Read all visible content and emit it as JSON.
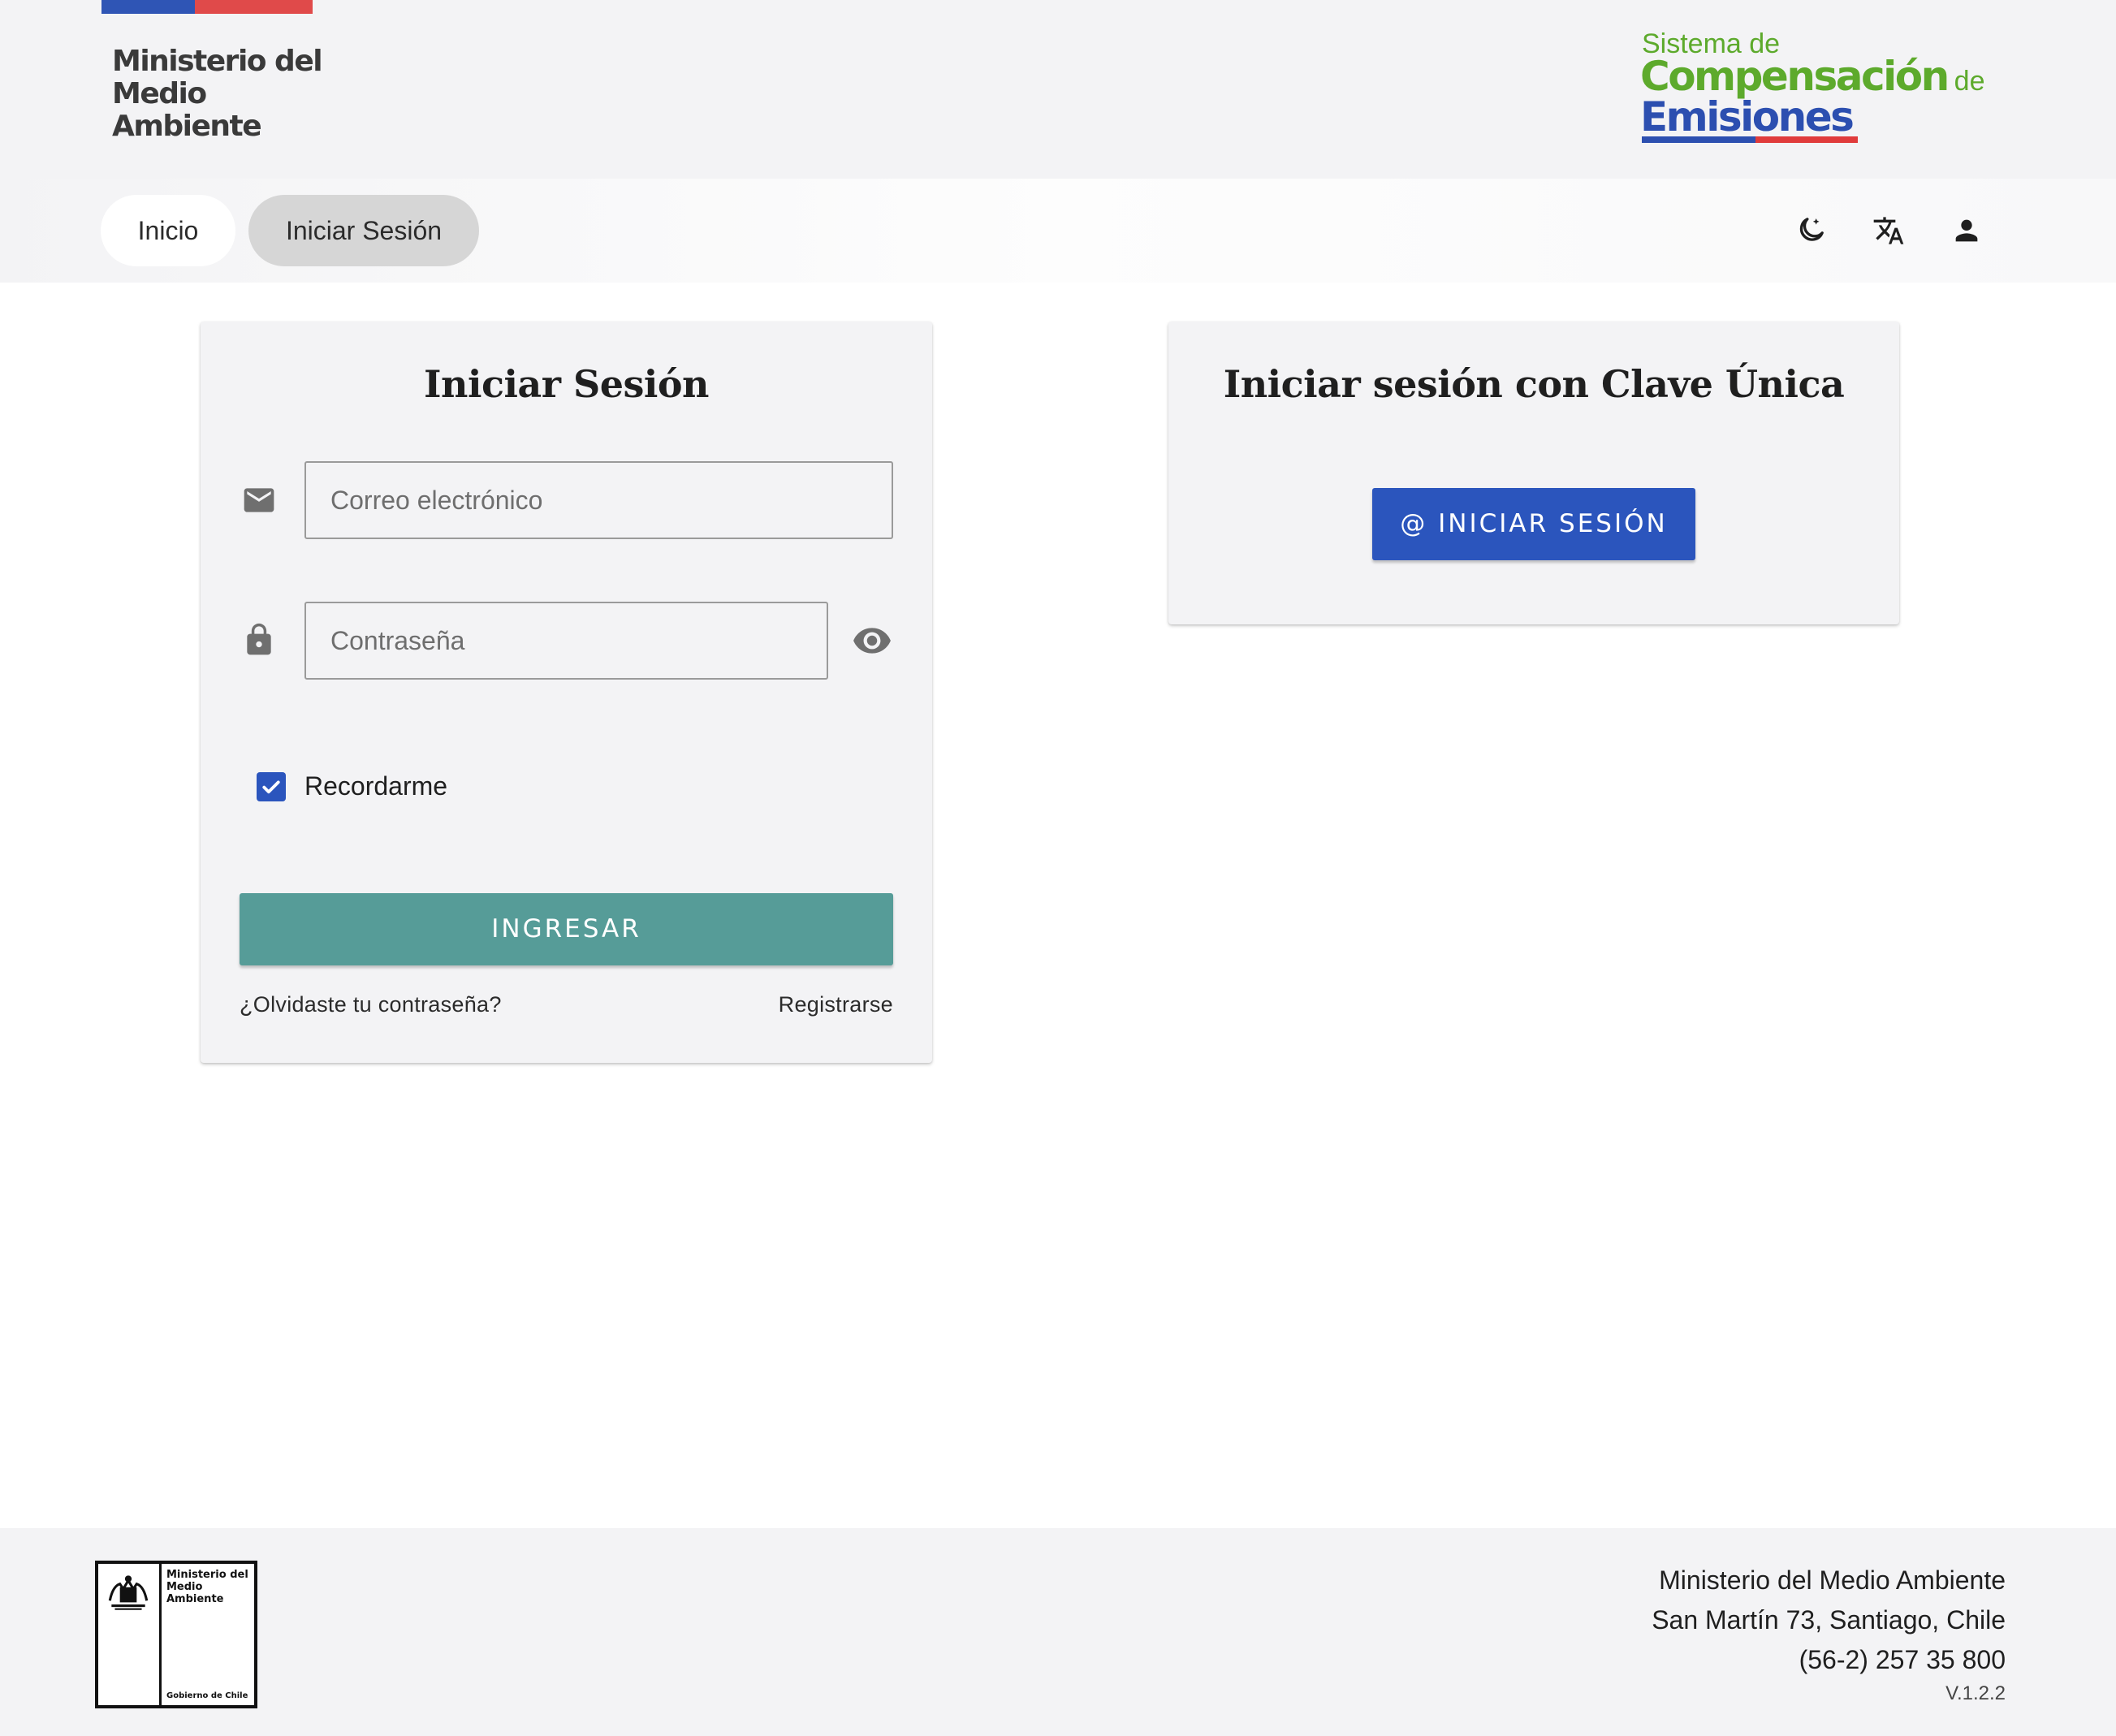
{
  "colors": {
    "flag_blue": "#2f55b5",
    "flag_red": "#e04a4a",
    "logo_green": "#5daa2c",
    "logo_blue": "#2c4fb0",
    "logo_red": "#e03b3b",
    "primary_blue": "#2b55bd",
    "teal": "#569c98",
    "icon_gray": "#6f6f6f",
    "checkbox_blue": "#2b55bd"
  },
  "header": {
    "ministry_logo_lines": [
      "Ministerio del",
      "Medio",
      "Ambiente"
    ],
    "system_logo": {
      "line1": "Sistema de",
      "line2": "Compensación",
      "line2_suffix": "de",
      "line3": "Emisiones"
    }
  },
  "nav": {
    "items": [
      {
        "label": "Inicio",
        "active": false
      },
      {
        "label": "Iniciar Sesión",
        "active": true
      }
    ],
    "icons": [
      "dark-mode-icon",
      "translate-icon",
      "account-icon"
    ]
  },
  "login_card": {
    "title": "Iniciar Sesión",
    "email": {
      "placeholder": "Correo electrónico",
      "value": "",
      "icon": "email-icon"
    },
    "password": {
      "placeholder": "Contraseña",
      "value": "",
      "icon": "lock-icon",
      "toggle_icon": "visibility-icon"
    },
    "remember": {
      "label": "Recordarme",
      "checked": true
    },
    "submit_label": "INGRESAR",
    "forgot_label": "¿Olvidaste tu contraseña?",
    "register_label": "Registrarse"
  },
  "clave_card": {
    "title": "Iniciar sesión con Clave Única",
    "button_label": "@ INICIAR SESIÓN"
  },
  "footer": {
    "logo_lines": [
      "Ministerio del",
      "Medio",
      "Ambiente"
    ],
    "logo_sub": "Gobierno de Chile",
    "address_lines": [
      "Ministerio del Medio Ambiente",
      "San Martín 73, Santiago, Chile",
      "(56-2) 257 35 800"
    ],
    "version": "V.1.2.2"
  }
}
